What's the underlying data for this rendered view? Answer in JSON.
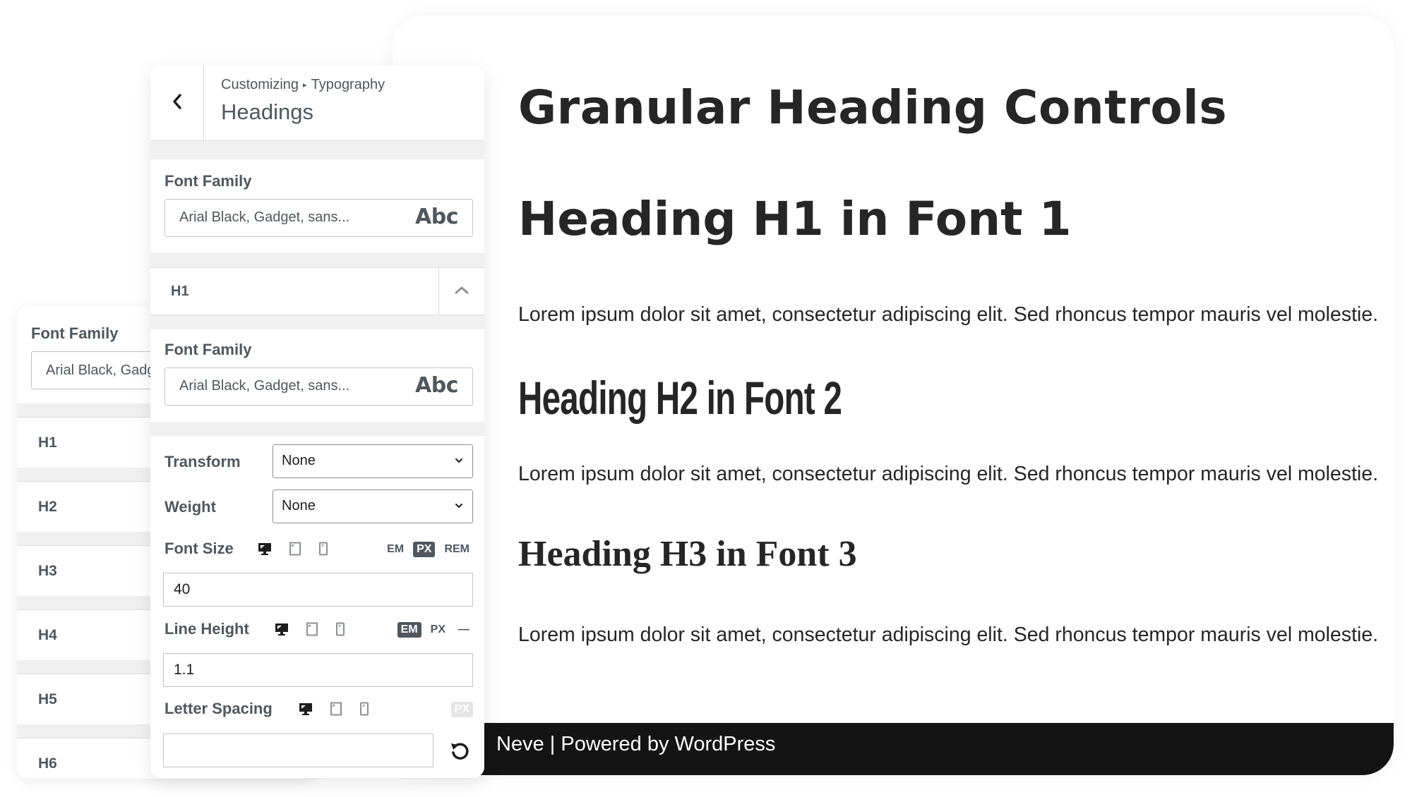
{
  "preview": {
    "title": "Granular Heading Controls",
    "h1": "Heading H1 in Font 1",
    "h2": "Heading H2 in Font 2",
    "h3": "Heading H3 in Font 3",
    "paragraphs": [
      "Lorem ipsum dolor sit amet, consectetur adipiscing elit. Sed rhoncus tempor mauris vel molestie.",
      "Lorem ipsum dolor sit amet, consectetur adipiscing elit. Sed rhoncus tempor mauris vel molestie.",
      "Lorem ipsum dolor sit amet, consectetur adipiscing elit. Sed rhoncus tempor mauris vel molestie."
    ],
    "footer": "Neve | Powered by WordPress",
    "footer_bg": "#141414"
  },
  "back_panel": {
    "font_family_label": "Font Family",
    "font_family_value": "Arial Black, Gadget, sans...",
    "headings": [
      "H1",
      "H2",
      "H3",
      "H4",
      "H5",
      "H6"
    ]
  },
  "panel": {
    "breadcrumb": [
      "Customizing",
      "Typography"
    ],
    "breadcrumb_sep": "▸",
    "title": "Headings",
    "global_font_family": {
      "label": "Font Family",
      "value": "Arial Black, Gadget, sans...",
      "preview": "Abc"
    },
    "h1_section": {
      "label": "H1",
      "expanded": true,
      "font_family": {
        "label": "Font Family",
        "value": "Arial Black, Gadget, sans...",
        "preview": "Abc"
      },
      "transform": {
        "label": "Transform",
        "value": "None"
      },
      "weight": {
        "label": "Weight",
        "value": "None"
      },
      "font_size": {
        "label": "Font Size",
        "units": [
          "EM",
          "PX",
          "REM"
        ],
        "active_unit": "PX",
        "value": "40",
        "active_device": "desktop"
      },
      "line_height": {
        "label": "Line Height",
        "units": [
          "EM",
          "PX",
          "—"
        ],
        "active_unit": "EM",
        "value": "1.1",
        "active_device": "desktop"
      },
      "letter_spacing": {
        "label": "Letter Spacing",
        "units": [
          "PX"
        ],
        "value": "",
        "active_device": "desktop"
      }
    }
  }
}
